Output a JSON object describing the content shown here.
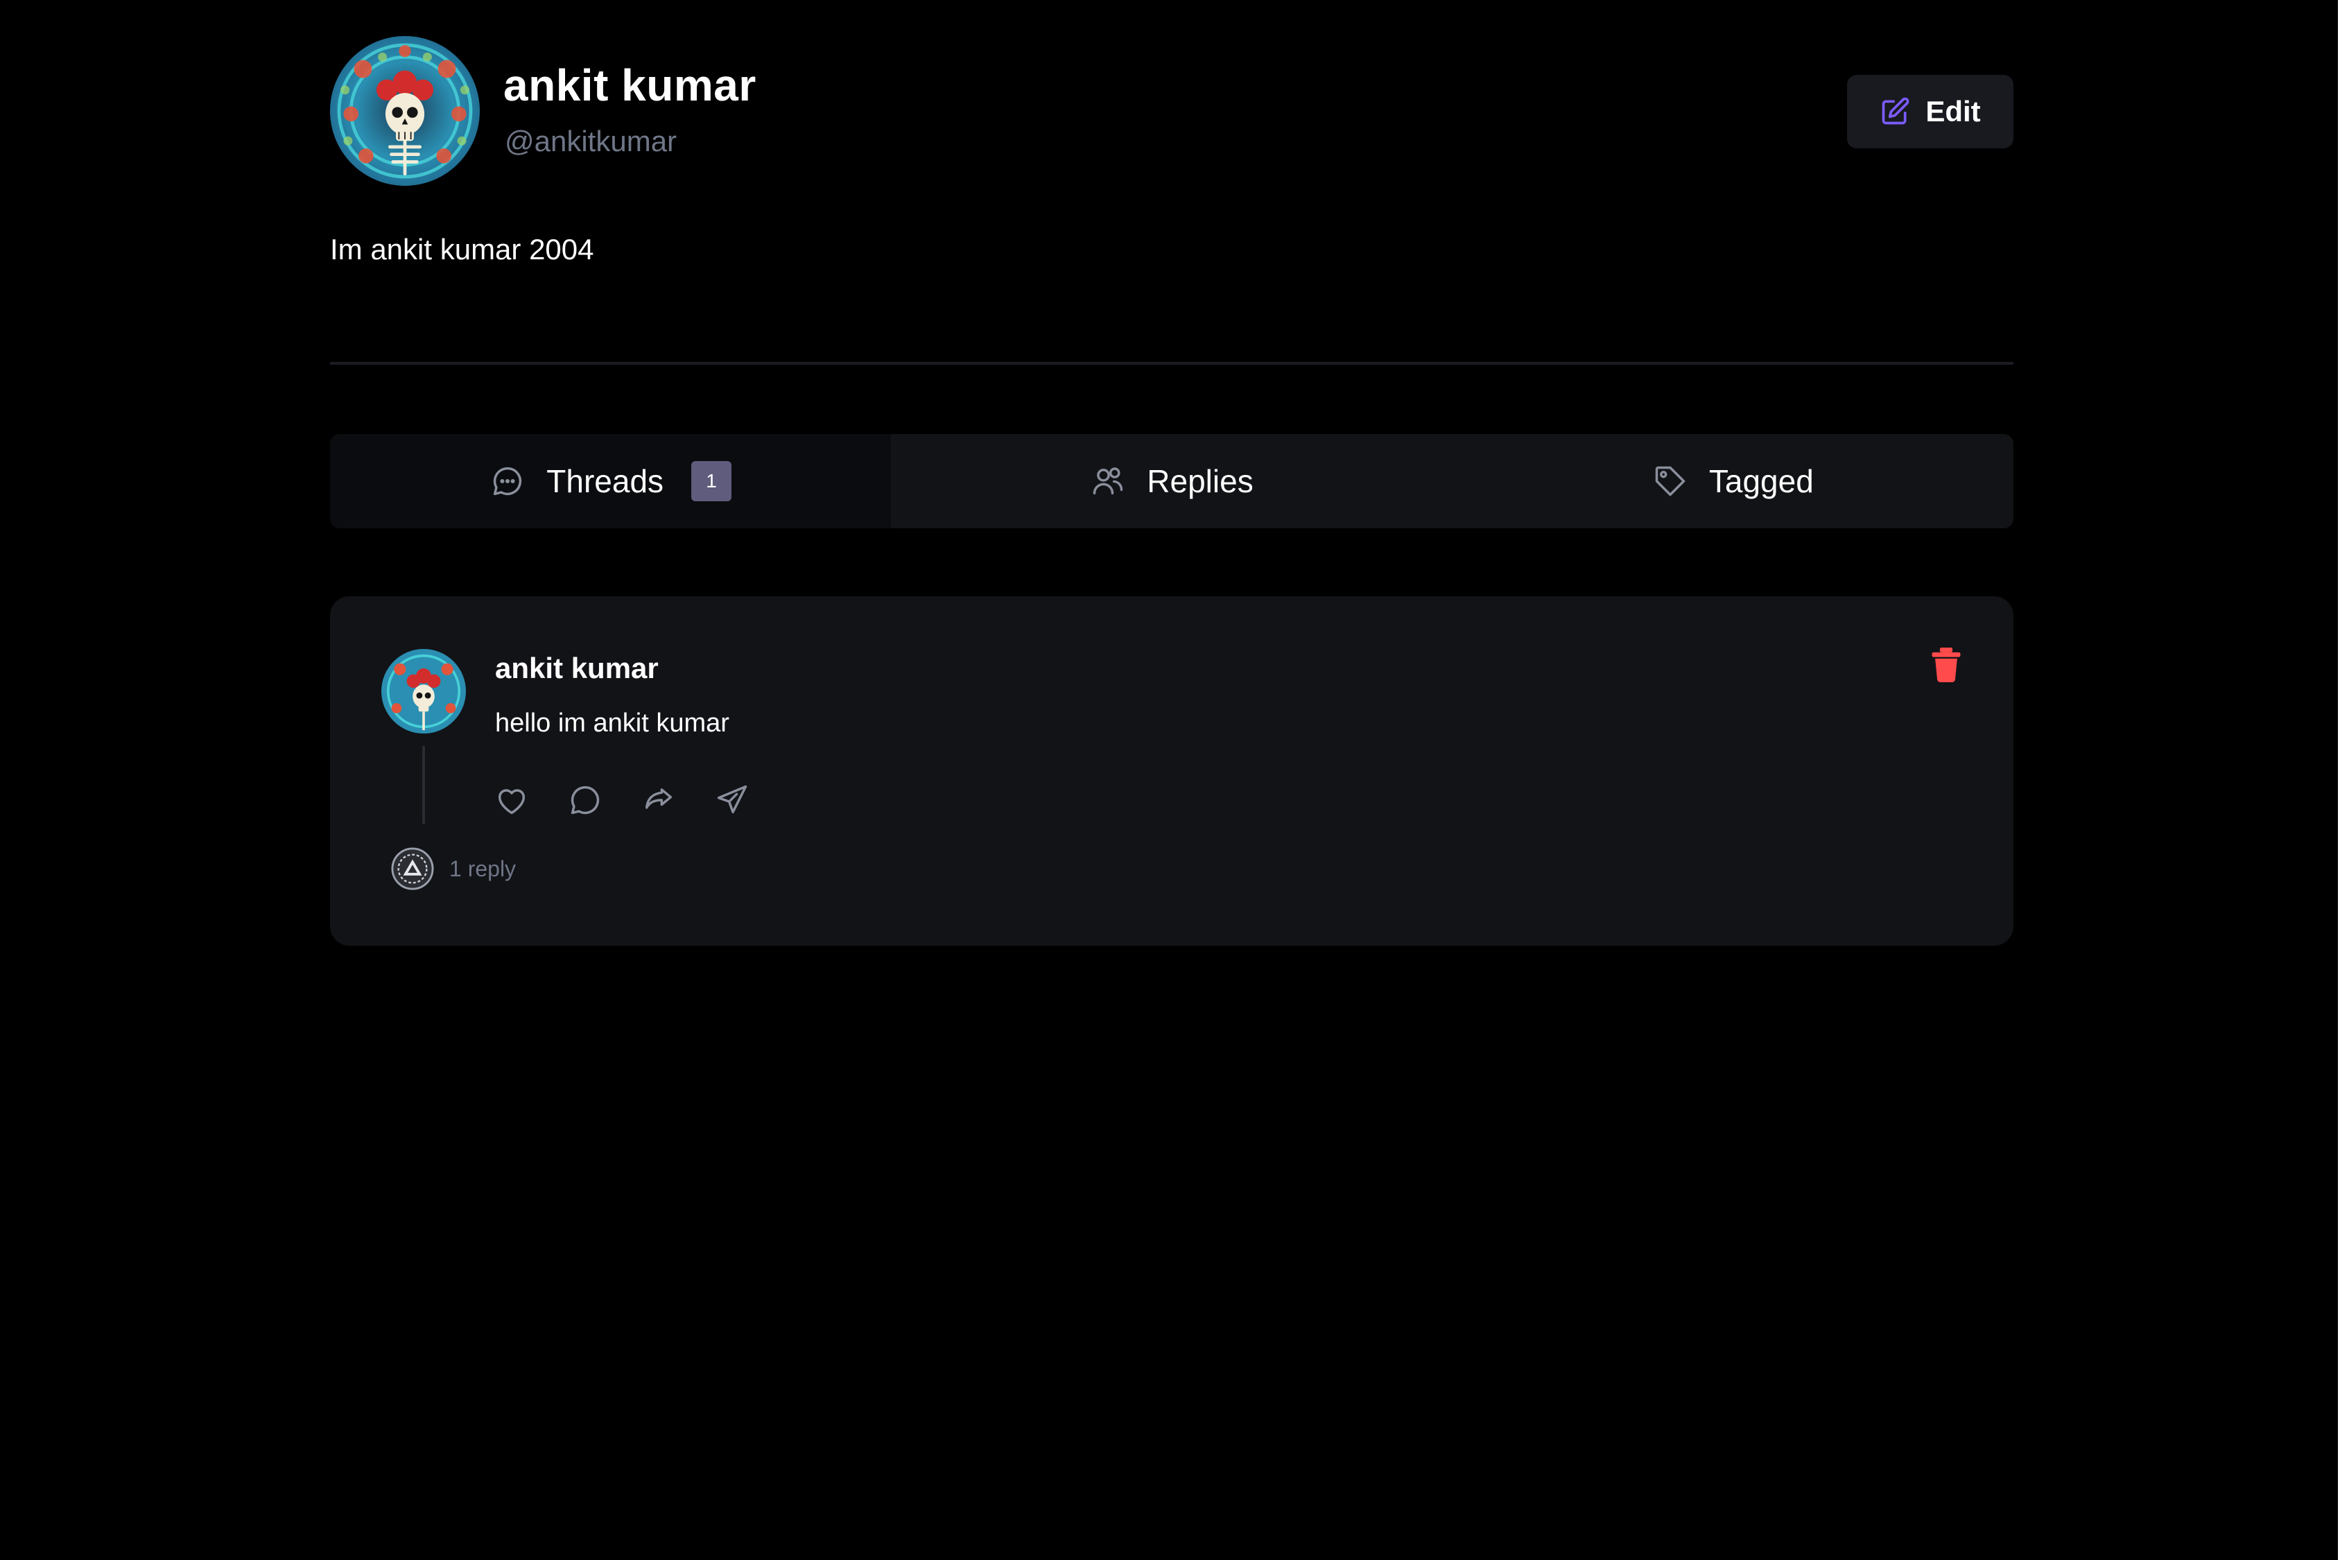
{
  "profile": {
    "name": "ankit kumar",
    "handle": "@ankitkumar",
    "bio": "Im ankit kumar 2004",
    "edit_label": "Edit",
    "avatar_icon": "skull-roses-avatar"
  },
  "tabs": [
    {
      "label": "Threads",
      "icon": "chat-bubble-icon",
      "count": "1",
      "active": true
    },
    {
      "label": "Replies",
      "icon": "users-icon",
      "active": false
    },
    {
      "label": "Tagged",
      "icon": "tag-icon",
      "active": false
    }
  ],
  "thread": {
    "author": "ankit kumar",
    "text": "hello im ankit kumar",
    "reply_count_label": "1 reply",
    "actions": [
      "heart-icon",
      "comment-icon",
      "repost-icon",
      "send-icon"
    ],
    "delete_icon": "trash-icon"
  },
  "colors": {
    "background": "#000000",
    "card": "#121317",
    "accent_edit": "#7c5cff",
    "delete": "#ff4b4b",
    "muted": "#6f7687",
    "badge": "#5f5c7d"
  }
}
